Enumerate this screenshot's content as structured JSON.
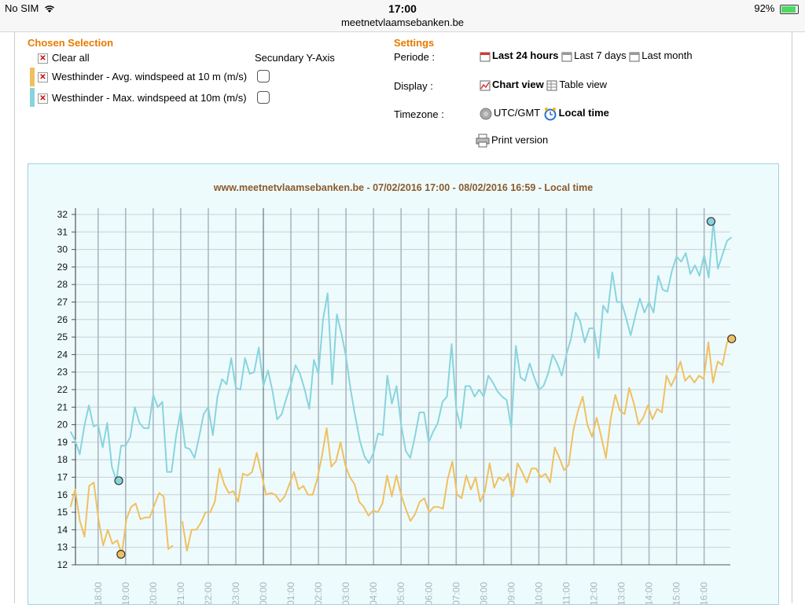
{
  "status": {
    "carrier": "No SIM",
    "time": "17:00",
    "url": "meetnetvlaamsebanken.be",
    "battery": "92%"
  },
  "selection": {
    "heading": "Chosen Selection",
    "clear_all": "Clear all",
    "secondary_axis": "Secundary Y-Axis",
    "series": [
      {
        "label": "Westhinder - Avg. windspeed at 10 m (m/s)",
        "color": "#f0c060"
      },
      {
        "label": "Westhinder - Max. windspeed at 10m (m/s)",
        "color": "#88d4de"
      }
    ]
  },
  "settings": {
    "heading": "Settings",
    "periode_label": "Periode :",
    "periode_options": [
      "Last 24 hours",
      "Last 7 days",
      "Last month"
    ],
    "display_label": "Display :",
    "display_options": [
      "Chart view",
      "Table view"
    ],
    "timezone_label": "Timezone :",
    "timezone_options": [
      "UTC/GMT",
      "Local time"
    ],
    "print": "Print version"
  },
  "chart_data": {
    "type": "line",
    "title": "www.meetnetvlaamsebanken.be - 07/02/2016 17:00 - 08/02/2016 16:59 - Local time",
    "ylim": [
      12,
      32
    ],
    "yticks": [
      12,
      13,
      14,
      15,
      16,
      17,
      18,
      19,
      20,
      21,
      22,
      23,
      24,
      25,
      26,
      27,
      28,
      29,
      30,
      31,
      32
    ],
    "x_start_hour": 17,
    "x_end_hour": 41,
    "xticks": [
      "18:00",
      "19:00",
      "20:00",
      "21:00",
      "22:00",
      "23:00",
      "00:00",
      "01:00",
      "02:00",
      "03:00",
      "04:00",
      "05:00",
      "06:00",
      "07:00",
      "08:00",
      "09:00",
      "10:00",
      "11:00",
      "12:00",
      "13:00",
      "14:00",
      "15:00",
      "16:00"
    ],
    "series": [
      {
        "name": "Westhinder - Avg. windspeed at 10 m (m/s)",
        "color": "#f0c060",
        "values": [
          15.3,
          16.3,
          14.5,
          13.6,
          16.5,
          16.7,
          14.6,
          13.1,
          14.0,
          13.2,
          13.4,
          12.6,
          14.6,
          15.3,
          15.5,
          14.6,
          14.7,
          14.7,
          15.4,
          16.1,
          15.9,
          12.9,
          13.1,
          null,
          14.5,
          12.8,
          14.0,
          14.0,
          14.4,
          15.0,
          15.0,
          15.6,
          17.5,
          16.6,
          16.1,
          16.2,
          15.6,
          17.2,
          17.1,
          17.3,
          18.4,
          17.2,
          16.0,
          16.1,
          16.0,
          15.6,
          15.9,
          16.6,
          17.3,
          16.3,
          16.5,
          16.0,
          16.0,
          16.9,
          18.2,
          19.8,
          17.6,
          17.9,
          19.0,
          17.7,
          17.0,
          16.6,
          15.6,
          15.3,
          14.8,
          15.1,
          15.0,
          15.5,
          17.1,
          15.9,
          17.1,
          16.0,
          15.2,
          14.5,
          14.9,
          15.6,
          15.8,
          15.0,
          15.3,
          15.3,
          15.2,
          16.9,
          17.9,
          16.0,
          15.8,
          17.1,
          16.3,
          17.0,
          15.6,
          16.2,
          17.8,
          16.4,
          17.0,
          16.8,
          17.2,
          15.9,
          17.8,
          17.3,
          16.7,
          17.5,
          17.5,
          17.0,
          17.2,
          16.7,
          18.7,
          18.1,
          17.4,
          17.7,
          19.7,
          20.8,
          21.6,
          20.0,
          19.3,
          20.4,
          19.3,
          18.1,
          20.3,
          21.7,
          20.8,
          20.6,
          22.1,
          21.2,
          20.0,
          20.4,
          21.1,
          20.3,
          20.9,
          20.7,
          22.8,
          22.2,
          22.8,
          23.6,
          22.5,
          22.8,
          22.4,
          22.8,
          22.6,
          24.7,
          22.4,
          23.6,
          23.4,
          24.7,
          24.9
        ]
      },
      {
        "name": "Westhinder - Max. windspeed at 10m (m/s)",
        "color": "#88d4de",
        "values": [
          19.6,
          19.1,
          18.3,
          19.9,
          21.1,
          19.9,
          20.0,
          18.7,
          20.1,
          17.6,
          16.8,
          18.8,
          18.8,
          19.3,
          21.0,
          20.1,
          19.8,
          19.8,
          21.7,
          21.0,
          21.3,
          17.3,
          17.3,
          19.4,
          20.8,
          18.7,
          18.6,
          18.1,
          19.3,
          20.6,
          21.0,
          19.4,
          21.6,
          22.6,
          22.3,
          23.8,
          22.1,
          22.0,
          23.8,
          22.9,
          23.0,
          24.4,
          22.2,
          23.1,
          21.9,
          20.3,
          20.6,
          21.5,
          22.3,
          23.4,
          22.9,
          22.0,
          20.9,
          23.7,
          22.9,
          26.0,
          27.5,
          22.3,
          26.3,
          25.2,
          23.9,
          22.0,
          20.5,
          19.1,
          18.2,
          17.8,
          18.4,
          19.5,
          19.4,
          22.8,
          21.2,
          22.2,
          20.0,
          18.5,
          18.1,
          19.3,
          20.7,
          20.7,
          19.0,
          19.6,
          20.1,
          21.3,
          21.6,
          24.6,
          20.9,
          19.8,
          22.2,
          22.2,
          21.6,
          22.0,
          21.6,
          22.8,
          22.4,
          21.9,
          21.6,
          21.4,
          19.8,
          24.5,
          22.7,
          22.5,
          23.5,
          22.7,
          22.0,
          22.2,
          22.9,
          24.0,
          23.5,
          22.8,
          24.0,
          24.9,
          26.4,
          25.9,
          24.7,
          25.5,
          25.5,
          23.8,
          26.8,
          26.4,
          28.7,
          27.0,
          27.0,
          26.1,
          25.1,
          26.2,
          27.2,
          26.4,
          27.0,
          26.4,
          28.5,
          27.7,
          27.6,
          28.8,
          29.6,
          29.3,
          29.8,
          28.6,
          29.1,
          28.5,
          29.7,
          28.4,
          31.6,
          28.9,
          29.7,
          30.5,
          30.7
        ]
      }
    ],
    "highlights": [
      {
        "series": 1,
        "x_hour": 18.75,
        "value": 16.8
      },
      {
        "series": 0,
        "x_hour": 18.83,
        "value": 12.6
      },
      {
        "series": 1,
        "x_hour": 40.25,
        "value": 31.6
      },
      {
        "series": 0,
        "x_hour": 41.0,
        "value": 24.9
      }
    ]
  }
}
